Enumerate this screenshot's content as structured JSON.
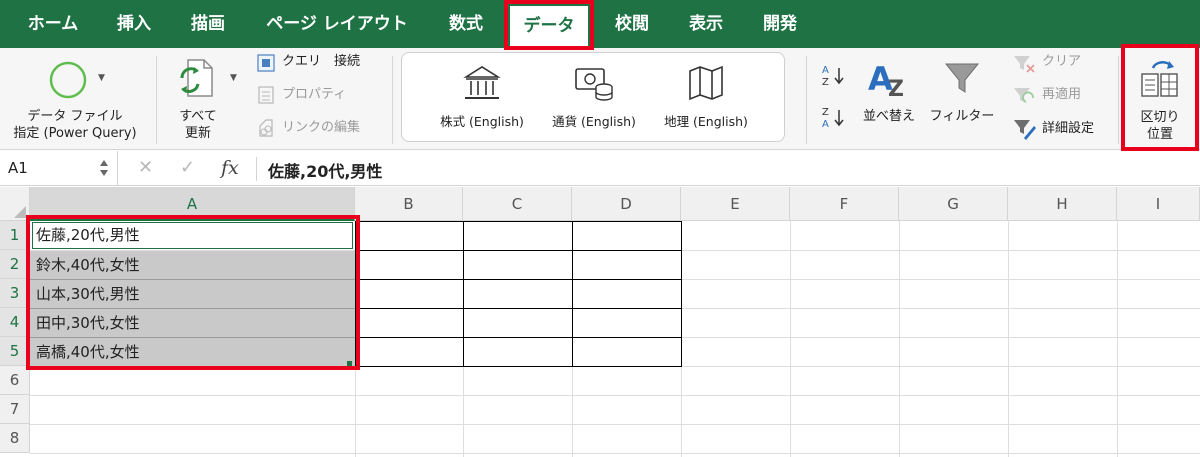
{
  "tabs": [
    {
      "label": "ホーム",
      "active": false
    },
    {
      "label": "挿入",
      "active": false
    },
    {
      "label": "描画",
      "active": false
    },
    {
      "label": "ページ レイアウト",
      "active": false
    },
    {
      "label": "数式",
      "active": false
    },
    {
      "label": "データ",
      "active": true
    },
    {
      "label": "校閲",
      "active": false
    },
    {
      "label": "表示",
      "active": false
    },
    {
      "label": "開発",
      "active": false
    }
  ],
  "ribbon": {
    "get_data_line1": "データ ファイル",
    "get_data_line2": "指定 (Power Query)",
    "refresh_line1": "すべて",
    "refresh_line2": "更新",
    "queries_connections": "クエリ　接続",
    "properties": "プロパティ",
    "edit_links": "リンクの編集",
    "data_types": [
      {
        "label": "株式 (English)",
        "icon": "bank-icon"
      },
      {
        "label": "通貨 (English)",
        "icon": "currency-icon"
      },
      {
        "label": "地理 (English)",
        "icon": "map-icon"
      }
    ],
    "sort": "並べ替え",
    "filter": "フィルター",
    "clear": "クリア",
    "reapply": "再適用",
    "advanced": "詳細設定",
    "text_to_columns_line1": "区切り",
    "text_to_columns_line2": "位置"
  },
  "formula_bar": {
    "name_box": "A1",
    "cancel": "✕",
    "enter": "✓",
    "fx": "fx",
    "value": "佐藤,20代,男性"
  },
  "grid": {
    "columns": [
      "A",
      "B",
      "C",
      "D",
      "E",
      "F",
      "G",
      "H",
      "I"
    ],
    "rows": [
      "1",
      "2",
      "3",
      "4",
      "5",
      "6",
      "7",
      "8"
    ],
    "cells": [
      "佐藤,20代,男性",
      "鈴木,40代,女性",
      "山本,30代,男性",
      "田中,30代,女性",
      "高橋,40代,女性"
    ]
  },
  "colors": {
    "excel_green": "#1f7244",
    "highlight_red": "#e8001c",
    "selection_gray": "#c9c9c9"
  }
}
